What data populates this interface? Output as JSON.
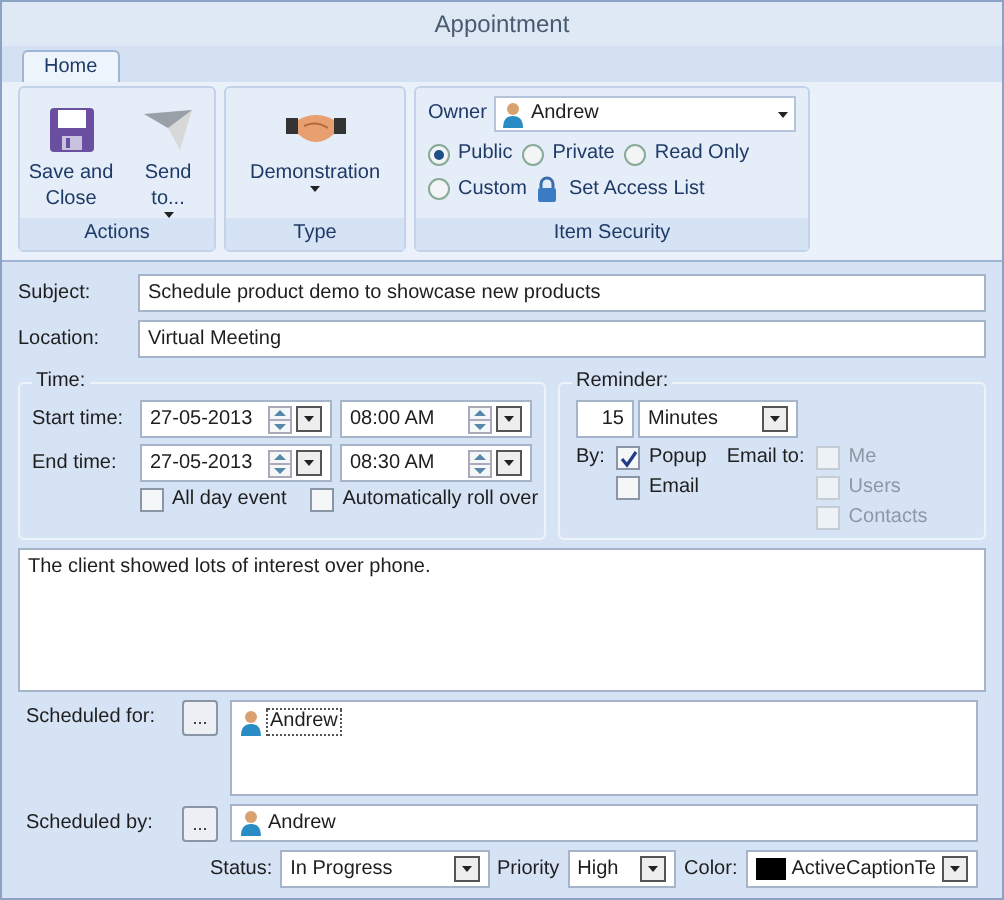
{
  "window": {
    "title": "Appointment"
  },
  "tabs": [
    {
      "label": "Home",
      "selected": true
    }
  ],
  "ribbon": {
    "groups": [
      {
        "label": "Actions",
        "buttons": [
          {
            "label": "Save and Close",
            "kind": "save",
            "dropdown": false
          },
          {
            "label": "Send to...",
            "kind": "send",
            "dropdown": true
          }
        ]
      },
      {
        "label": "Type",
        "buttons": [
          {
            "label": "Demonstration",
            "kind": "handshake",
            "dropdown": true
          }
        ]
      },
      {
        "label": "Item Security",
        "owner_label": "Owner",
        "owner": "Andrew",
        "access": [
          {
            "label": "Public",
            "selected": true
          },
          {
            "label": "Private",
            "selected": false
          },
          {
            "label": "Read Only",
            "selected": false
          },
          {
            "label": "Custom",
            "selected": false
          }
        ],
        "access_list_button": "Set Access List"
      }
    ]
  },
  "subject": {
    "label": "Subject:",
    "value": "Schedule product demo to showcase new products"
  },
  "location": {
    "label": "Location:",
    "value": "Virtual Meeting"
  },
  "time": {
    "title": "Time:",
    "rows": [
      {
        "label": "Start time:",
        "date": "27-05-2013",
        "time": "08:00 AM"
      },
      {
        "label": "End time:",
        "date": "27-05-2013",
        "time": "08:30 AM"
      }
    ],
    "options": [
      {
        "label": "All day event",
        "checked": false
      },
      {
        "label": "Automatically roll over",
        "checked": false
      }
    ]
  },
  "reminder": {
    "title": "Reminder:",
    "amount": "15",
    "unit": "Minutes",
    "by_label": "By:",
    "by": [
      {
        "label": "Popup",
        "checked": true
      },
      {
        "label": "Email",
        "checked": false
      }
    ],
    "email_to_label": "Email to:",
    "email_to": [
      {
        "label": "Me",
        "checked": false,
        "disabled": true
      },
      {
        "label": "Users",
        "checked": false,
        "disabled": true
      },
      {
        "label": "Contacts",
        "checked": false,
        "disabled": true
      }
    ]
  },
  "notes": "The client showed lots of interest over phone.",
  "scheduled_for": {
    "label": "Scheduled for:",
    "button": "...",
    "people": [
      "Andrew"
    ]
  },
  "scheduled_by": {
    "label": "Scheduled by:",
    "button": "...",
    "person": "Andrew"
  },
  "status": {
    "label": "Status:",
    "value": "In Progress"
  },
  "priority": {
    "label": "Priority",
    "value": "High"
  },
  "color": {
    "label": "Color:",
    "value": "ActiveCaptionTe",
    "color": "#000000"
  }
}
